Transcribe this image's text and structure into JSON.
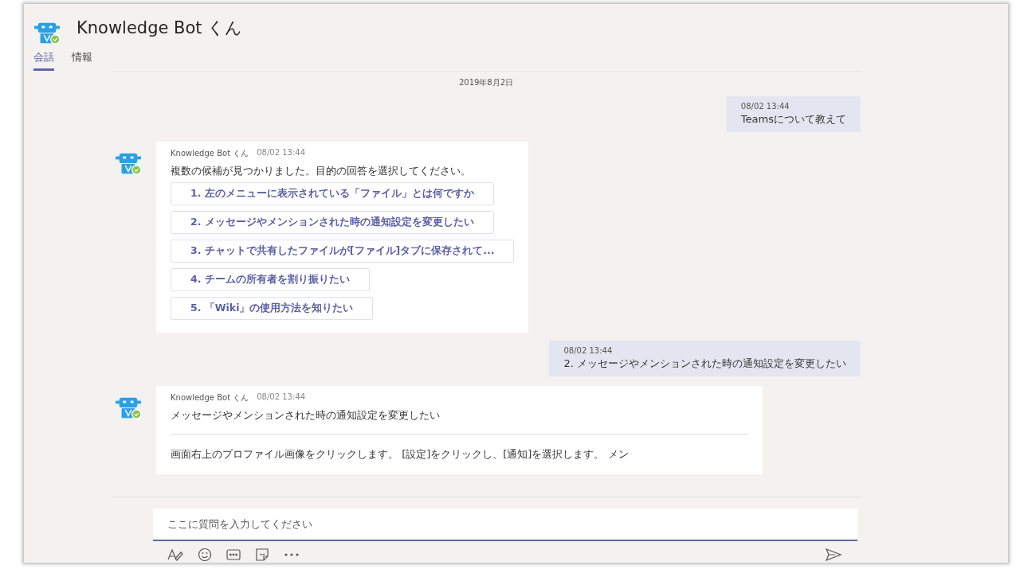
{
  "header": {
    "title": "Knowledge Bot くん",
    "tabs": [
      {
        "label": "会話",
        "selected": true
      },
      {
        "label": "情報",
        "selected": false
      }
    ]
  },
  "date_divider": "2019年8月2日",
  "messages": [
    {
      "kind": "sent",
      "time": "08/02 13:44",
      "text": "Teamsについて教えて"
    },
    {
      "kind": "bot",
      "sender": "Knowledge Bot くん",
      "time": "08/02 13:44",
      "text": "複数の候補が見つかりました。目的の回答を選択してください。",
      "options": [
        "1. 左のメニューに表示されている「ファイル」とは何ですか",
        "2. メッセージやメンションされた時の通知設定を変更したい",
        "3. チャットで共有したファイルが[ファイル]タブに保存されて...",
        "4. チームの所有者を割り振りたい",
        "5. 「Wiki」の使用方法を知りたい"
      ]
    },
    {
      "kind": "sent",
      "time": "08/02 13:44",
      "text": "2. メッセージやメンションされた時の通知設定を変更したい"
    },
    {
      "kind": "bot",
      "sender": "Knowledge Bot くん",
      "time": "08/02 13:44",
      "text": "メッセージやメンションされた時の通知設定を変更したい",
      "body": "画面右上のプロファイル画像をクリックします。 [設定]をクリックし、[通知]を選択します。 メン"
    }
  ],
  "composer": {
    "placeholder": "ここに質問を入力してください"
  }
}
